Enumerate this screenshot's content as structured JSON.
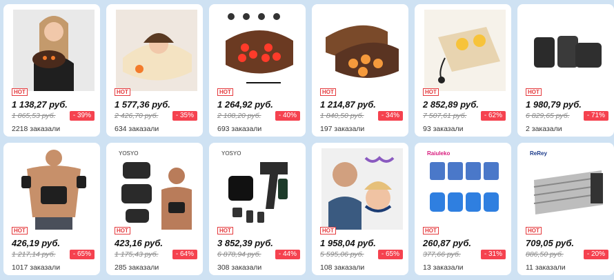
{
  "hot_label": "HOT",
  "products": [
    {
      "price": "1 138,27 руб.",
      "old_price": "1 865,53 руб.",
      "discount": "- 39%",
      "orders": "2218 заказали",
      "icon": "massage-pillow-woman-icon",
      "brand": ""
    },
    {
      "price": "1 577,36 руб.",
      "old_price": "2 426,70 руб.",
      "discount": "- 35%",
      "orders": "634 заказали",
      "icon": "neck-pillow-icon",
      "brand": ""
    },
    {
      "price": "1 264,92 руб.",
      "old_price": "2 108,20 руб.",
      "discount": "- 40%",
      "orders": "693 заказали",
      "icon": "shiatsu-massager-icon",
      "brand": ""
    },
    {
      "price": "1 214,87 руб.",
      "old_price": "1 840,50 руб.",
      "discount": "- 34%",
      "orders": "197 заказали",
      "icon": "heated-massage-pillow-icon",
      "brand": ""
    },
    {
      "price": "2 852,89 руб.",
      "old_price": "7 507,61 руб.",
      "discount": "- 62%",
      "orders": "93 заказали",
      "icon": "neck-massager-cushion-icon",
      "brand": ""
    },
    {
      "price": "1 980,79 руб.",
      "old_price": "6 829,65 руб.",
      "discount": "- 71%",
      "orders": "2 заказали",
      "icon": "wearable-wraps-icon",
      "brand": ""
    },
    {
      "price": "426,19 руб.",
      "old_price": "1 217,14 руб.",
      "discount": "- 65%",
      "orders": "1017 заказали",
      "icon": "ems-abs-trainer-man-icon",
      "brand": ""
    },
    {
      "price": "423,16 руб.",
      "old_price": "1 175,43 руб.",
      "discount": "- 64%",
      "orders": "285 заказали",
      "icon": "ems-pads-set-icon",
      "brand": "YOSYO"
    },
    {
      "price": "3 852,39 руб.",
      "old_price": "6 878,94 руб.",
      "discount": "- 44%",
      "orders": "308 заказали",
      "icon": "massage-gun-icon",
      "brand": "YOSYO"
    },
    {
      "price": "1 958,04 руб.",
      "old_price": "5 595,06 руб.",
      "discount": "- 65%",
      "orders": "108 заказали",
      "icon": "neck-massager-people-icon",
      "brand": ""
    },
    {
      "price": "260,87 руб.",
      "old_price": "377,66 руб.",
      "discount": "- 31%",
      "orders": "13 заказали",
      "icon": "gel-pads-icon",
      "brand": "Raiuleko"
    },
    {
      "price": "709,05 руб.",
      "old_price": "886,50 руб.",
      "discount": "- 20%",
      "orders": "11 заказали",
      "icon": "waist-belt-icon",
      "brand": "ReRey"
    }
  ],
  "colors": {
    "background": "#cfe2f3",
    "discount": "#f5424f",
    "hot": "#e4393c"
  }
}
